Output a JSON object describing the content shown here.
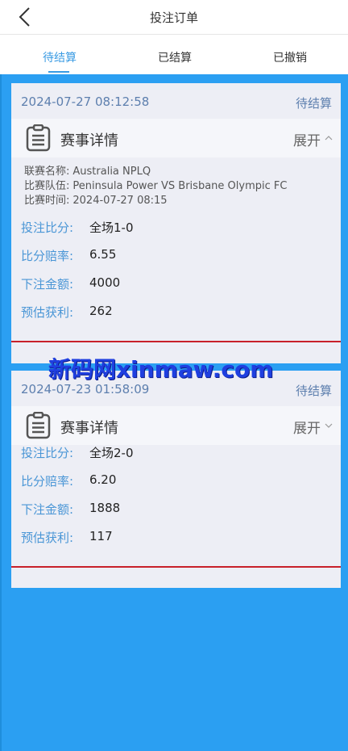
{
  "header": {
    "title": "投注订单"
  },
  "tabs": [
    {
      "label": "待结算"
    },
    {
      "label": "已结算"
    },
    {
      "label": "已撤销"
    }
  ],
  "orders": [
    {
      "date": "2024-07-27 08:12:58",
      "status": "待结算",
      "details_title": "赛事详情",
      "expand_label": "展开",
      "league_label": "联赛名称:",
      "league": "Australia NPLQ",
      "teams_label": "比赛队伍:",
      "teams": "Peninsula Power VS Brisbane Olympic FC",
      "time_label": "比赛时间:",
      "match_time": "2024-07-27 08:15",
      "score_label": "投注比分:",
      "score": "全场1-0",
      "odds_label": "比分赔率:",
      "odds": "6.55",
      "amount_label": "下注金额:",
      "amount": "4000",
      "profit_label": "预估获利:",
      "profit": "262"
    },
    {
      "date": "2024-07-23 01:58:09",
      "status": "待结算",
      "details_title": "赛事详情",
      "expand_label": "展开",
      "score_label": "投注比分:",
      "score": "全场2-0",
      "odds_label": "比分赔率:",
      "odds": "6.20",
      "amount_label": "下注金额:",
      "amount": "1888",
      "profit_label": "预估获利:",
      "profit": "117"
    }
  ],
  "watermark": "新码网xinmaw.com",
  "colors": {
    "accent": "#3a9be3",
    "background": "#2b9ff2",
    "card": "#edeef5",
    "divider": "#c8202a",
    "watermark": "#1f3fe0"
  },
  "icons": {
    "back": "chevron-left-icon",
    "details": "document-icon",
    "expand": "chevron-icon"
  }
}
